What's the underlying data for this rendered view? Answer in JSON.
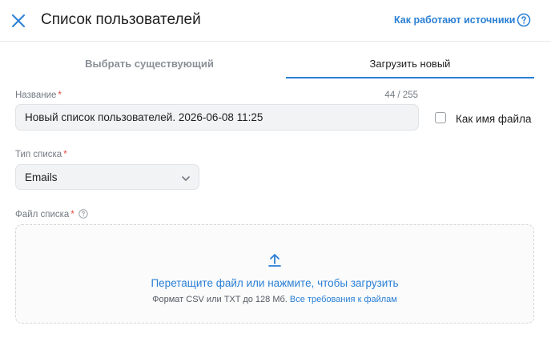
{
  "header": {
    "title": "Список пользователей",
    "help_link": "Как работают источники"
  },
  "tabs": [
    {
      "label": "Выбрать существующий",
      "active": false
    },
    {
      "label": "Загрузить новый",
      "active": true
    }
  ],
  "name_field": {
    "label": "Название",
    "required_mark": "*",
    "counter": "44 / 255",
    "value": "Новый список пользователей. 2026-06-08 11:25"
  },
  "filename_checkbox": {
    "label": "Как имя файла",
    "checked": false
  },
  "list_type": {
    "label": "Тип списка",
    "required_mark": "*",
    "selected": "Emails"
  },
  "file_field": {
    "label": "Файл списка",
    "required_mark": "*",
    "drop_text": "Перетащите файл или нажмите, чтобы загрузить",
    "format_text": "Формат CSV или TXT до 128 Мб.",
    "requirements_link": "Все требования к файлам"
  },
  "icons": {
    "close": "close-icon",
    "help": "question-circle-icon",
    "chevron": "chevron-down-icon",
    "upload": "upload-icon"
  },
  "colors": {
    "accent": "#2a7fd4",
    "required": "#e0493c"
  }
}
